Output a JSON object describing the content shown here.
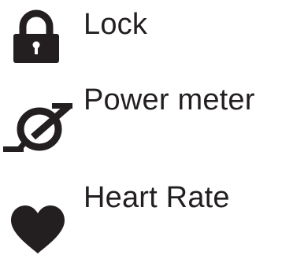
{
  "legend": {
    "items": [
      {
        "icon": "lock-icon",
        "label": "Lock"
      },
      {
        "icon": "power-meter-icon",
        "label": "Power meter"
      },
      {
        "icon": "heart-icon",
        "label": "Heart Rate"
      }
    ]
  },
  "colors": {
    "ink": "#231f20",
    "background": "#ffffff"
  }
}
